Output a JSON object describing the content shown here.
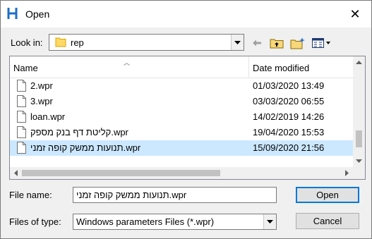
{
  "window": {
    "title": "Open",
    "close_glyph": "✕"
  },
  "look_in": {
    "label": "Look in:",
    "value": "rep"
  },
  "columns": {
    "name": "Name",
    "date_modified": "Date modified"
  },
  "files": [
    {
      "name": "2.wpr",
      "date": "01/03/2020 13:49",
      "selected": false
    },
    {
      "name": "3.wpr",
      "date": "03/03/2020 06:55",
      "selected": false
    },
    {
      "name": "loan.wpr",
      "date": "14/02/2019 14:26",
      "selected": false
    },
    {
      "name": "קליטת דף בנק מספק.wpr",
      "date": "19/04/2020 15:53",
      "selected": false
    },
    {
      "name": "תנועות ממשק קופה זמני.wpr",
      "date": "15/09/2020 21:56",
      "selected": true
    }
  ],
  "file_name": {
    "label": "File name:",
    "value": "תנועות ממשק קופה זמני.wpr"
  },
  "file_type": {
    "label": "Files of type:",
    "value": "Windows parameters Files (*.wpr)"
  },
  "buttons": {
    "open": "Open",
    "cancel": "Cancel"
  },
  "colors": {
    "selection": "#cce8ff",
    "accent": "#0078d7",
    "app_icon": "#1c6fc4"
  },
  "icons": [
    "app-icon",
    "close-icon",
    "folder-icon",
    "back-arrow-icon",
    "up-folder-icon",
    "new-folder-icon",
    "view-menu-icon",
    "file-icon",
    "sort-arrow-icon"
  ]
}
